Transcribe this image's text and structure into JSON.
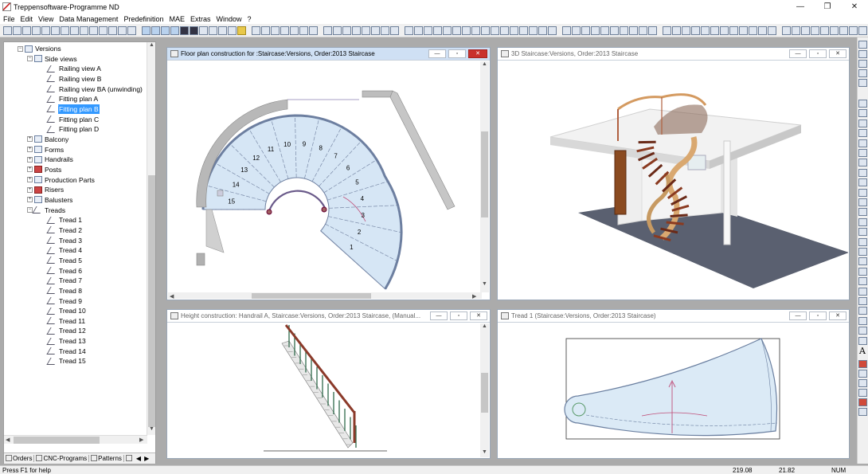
{
  "app": {
    "title": "Treppensoftware-Programme ND",
    "window_controls": [
      "—",
      "❐",
      "✕"
    ]
  },
  "menu": [
    "File",
    "Edit",
    "View",
    "Data Management",
    "Predefinition",
    "MAE",
    "Extras",
    "Window",
    "?"
  ],
  "tree": {
    "items": [
      {
        "label": "Versions",
        "level": 0,
        "expander": "−"
      },
      {
        "label": "Side views",
        "level": 1,
        "expander": "−"
      },
      {
        "label": "Railing view A",
        "level": 2
      },
      {
        "label": "Railing view B",
        "level": 2
      },
      {
        "label": "Railing view BA (unwinding)",
        "level": 2
      },
      {
        "label": "Fitting plan A",
        "level": 2
      },
      {
        "label": "Fitting plan B",
        "level": 2,
        "selected": true
      },
      {
        "label": "Fitting plan C",
        "level": 2
      },
      {
        "label": "Fitting plan D",
        "level": 2
      },
      {
        "label": "Balcony",
        "level": 1,
        "expander": "+"
      },
      {
        "label": "Forms",
        "level": 1,
        "expander": "+"
      },
      {
        "label": "Handrails",
        "level": 1,
        "expander": "+"
      },
      {
        "label": "Posts",
        "level": 1,
        "expander": "+"
      },
      {
        "label": "Production Parts",
        "level": 1,
        "expander": "+"
      },
      {
        "label": "Risers",
        "level": 1,
        "expander": "+"
      },
      {
        "label": "Balusters",
        "level": 1,
        "expander": "+"
      },
      {
        "label": "Treads",
        "level": 1,
        "expander": "−"
      },
      {
        "label": "Tread  1",
        "level": 2
      },
      {
        "label": "Tread  2",
        "level": 2
      },
      {
        "label": "Tread  3",
        "level": 2
      },
      {
        "label": "Tread  4",
        "level": 2
      },
      {
        "label": "Tread  5",
        "level": 2
      },
      {
        "label": "Tread  6",
        "level": 2
      },
      {
        "label": "Tread  7",
        "level": 2
      },
      {
        "label": "Tread  8",
        "level": 2
      },
      {
        "label": "Tread  9",
        "level": 2
      },
      {
        "label": "Tread 10",
        "level": 2
      },
      {
        "label": "Tread 11",
        "level": 2
      },
      {
        "label": "Tread 12",
        "level": 2
      },
      {
        "label": "Tread 13",
        "level": 2
      },
      {
        "label": "Tread 14",
        "level": 2
      },
      {
        "label": "Tread 15",
        "level": 2
      }
    ],
    "tabs": [
      "Orders",
      "CNC-Programs",
      "Patterns"
    ]
  },
  "windows": {
    "floor_plan": {
      "title": "Floor plan construction for :Staircase:Versions, Order:2013 Staircase",
      "tread_numbers": [
        "1",
        "2",
        "3",
        "4",
        "5",
        "6",
        "7",
        "8",
        "9",
        "10",
        "11",
        "12",
        "13",
        "14",
        "15"
      ]
    },
    "view3d": {
      "title": "3D Staircase:Versions, Order:2013 Staircase"
    },
    "height": {
      "title": "Height construction: Handrail A, Staircase:Versions, Order:2013 Staircase, (Manual..."
    },
    "tread": {
      "title": "Tread 1 (Staircase:Versions, Order:2013 Staircase)"
    }
  },
  "mdi_buttons": {
    "min": "—",
    "max": "▫",
    "close": "✕"
  },
  "status": {
    "help": "Press  F1  for help",
    "x": "219.08",
    "y": "21.82",
    "num": "NUM"
  }
}
